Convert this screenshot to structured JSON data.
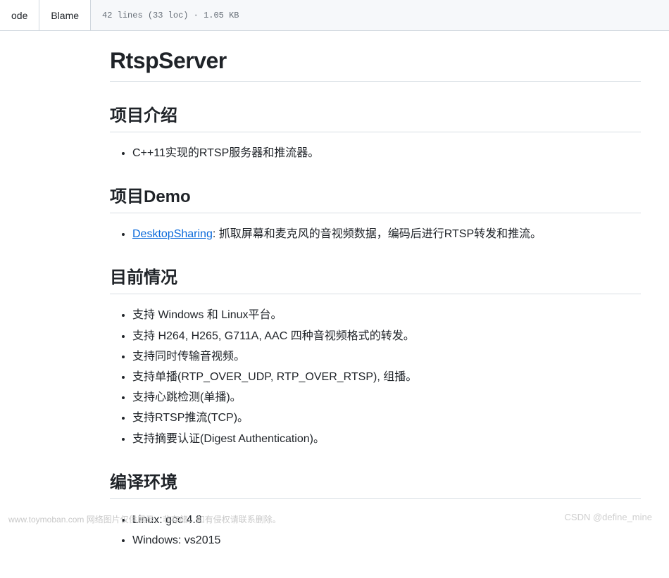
{
  "toolbar": {
    "tab_code": "ode",
    "tab_blame": "Blame",
    "file_info": "42 lines (33 loc) · 1.05 KB"
  },
  "page": {
    "title": "RtspServer",
    "sections": [
      {
        "heading": "项目介绍",
        "items": [
          {
            "text": "C++11实现的RTSP服务器和推流器。"
          }
        ]
      },
      {
        "heading": "项目Demo",
        "items": [
          {
            "link_text": "DesktopSharing",
            "text_after": ": 抓取屏幕和麦克风的音视频数据，编码后进行RTSP转发和推流。"
          }
        ]
      },
      {
        "heading": "目前情况",
        "items": [
          {
            "text": "支持 Windows 和 Linux平台。"
          },
          {
            "text": "支持 H264, H265, G711A, AAC 四种音视频格式的转发。"
          },
          {
            "text": "支持同时传输音视频。"
          },
          {
            "text": "支持单播(RTP_OVER_UDP, RTP_OVER_RTSP), 组播。"
          },
          {
            "text": "支持心跳检测(单播)。"
          },
          {
            "text": "支持RTSP推流(TCP)。"
          },
          {
            "text": "支持摘要认证(Digest Authentication)。"
          }
        ]
      },
      {
        "heading": "编译环境",
        "items": [
          {
            "text": "Linux: gcc 4.8"
          },
          {
            "text": "Windows: vs2015"
          }
        ]
      }
    ]
  },
  "watermarks": {
    "left": "www.toymoban.com  网络图片仅供展示，非存储，如有侵权请联系删除。",
    "right": "CSDN @define_mine"
  }
}
